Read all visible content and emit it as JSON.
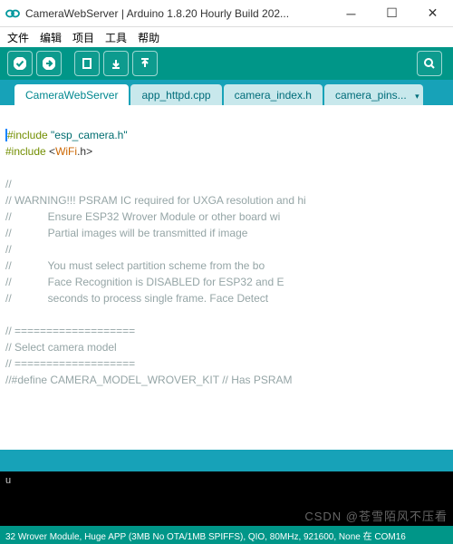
{
  "window": {
    "title": "CameraWebServer | Arduino 1.8.20 Hourly Build 202..."
  },
  "menu": {
    "file": "文件",
    "edit": "编辑",
    "sketch": "项目",
    "tools": "工具",
    "help": "帮助"
  },
  "tabs": {
    "t0": "CameraWebServer",
    "t1": "app_httpd.cpp",
    "t2": "camera_index.h",
    "t3": "camera_pins..."
  },
  "code": {
    "l1a": "#include ",
    "l1b": "\"esp_camera.h\"",
    "l2a": "#include ",
    "l2b": "<",
    "l2c": "WiFi",
    "l2d": ".h>",
    "l4": "//",
    "l5": "// WARNING!!! PSRAM IC required for UXGA resolution and hi",
    "l6": "//            Ensure ESP32 Wrover Module or other board wi",
    "l7": "//            Partial images will be transmitted if image ",
    "l8": "//",
    "l9": "//            You must select partition scheme from the bo",
    "l10": "//            Face Recognition is DISABLED for ESP32 and E",
    "l11": "//            seconds to process single frame. Face Detect",
    "l12": "",
    "l13": "// ===================",
    "l14": "// Select camera model",
    "l15": "// ===================",
    "l16": "//#define CAMERA_MODEL_WROVER_KIT // Has PSRAM"
  },
  "console": {
    "line": "u"
  },
  "status": {
    "text": "32 Wrover Module, Huge APP (3MB No OTA/1MB SPIFFS), QIO, 80MHz, 921600, None 在 COM16"
  },
  "watermark": "CSDN @苍雪陌风不压看"
}
